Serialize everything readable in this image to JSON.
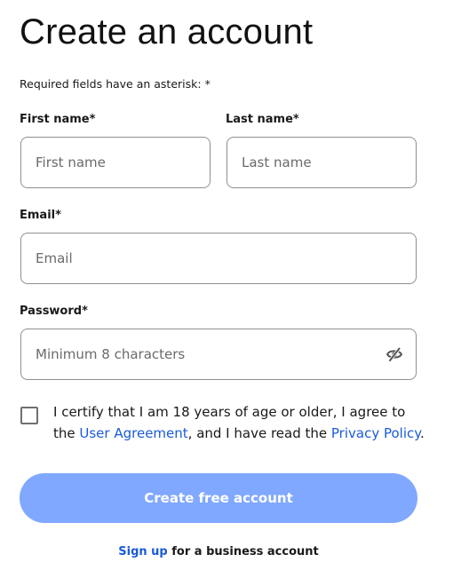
{
  "header": {
    "title": "Create an account",
    "required_note": "Required fields have an asterisk: *"
  },
  "form": {
    "first_name": {
      "label": "First name*",
      "placeholder": "First name",
      "value": ""
    },
    "last_name": {
      "label": "Last name*",
      "placeholder": "Last name",
      "value": ""
    },
    "email": {
      "label": "Email*",
      "placeholder": "Email",
      "value": ""
    },
    "password": {
      "label": "Password*",
      "placeholder": "Minimum 8 characters",
      "value": "",
      "toggle_icon": "eye-off-icon"
    },
    "certify": {
      "checked": false,
      "text_before": "I certify that I am 18 years of age or older, I agree to the ",
      "user_agreement_link": "User Agreement",
      "text_middle": ", and I have read the ",
      "privacy_policy_link": "Privacy Policy",
      "text_after": "."
    },
    "submit_label": "Create free account"
  },
  "footer": {
    "signup_link": "Sign up",
    "signup_text": " for a business account"
  },
  "colors": {
    "link": "#1a5bd8",
    "button_bg": "#80a8ff",
    "button_text": "#ffffff",
    "input_border": "#8f8f8f"
  }
}
